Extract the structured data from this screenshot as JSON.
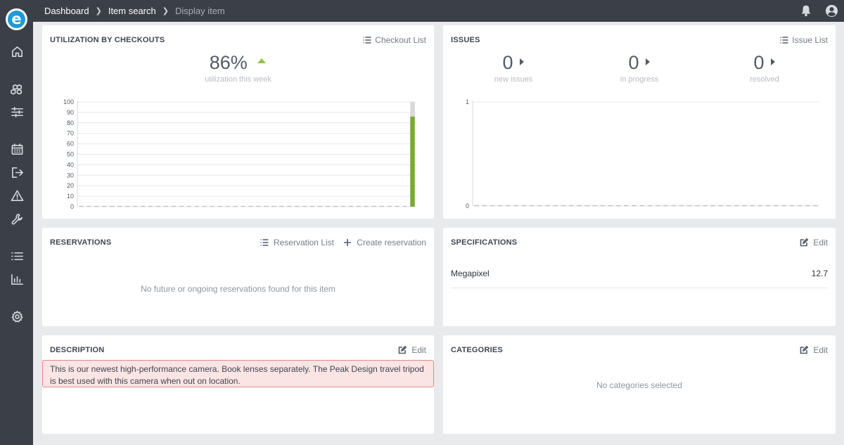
{
  "breadcrumb": {
    "items": [
      "Dashboard",
      "Item search",
      "Display item"
    ]
  },
  "sidebar": {
    "logo_letter": "e",
    "icons": [
      "home-icon",
      "boxes-icon",
      "sliders-icon",
      "calendar-icon",
      "checkout-icon",
      "warning-icon",
      "wrench-icon",
      "list-icon",
      "bar-chart-icon",
      "gear-icon"
    ]
  },
  "topbar": {
    "icons": [
      "bell-icon",
      "user-avatar-icon"
    ]
  },
  "utilization": {
    "title": "UTILIZATION BY CHECKOUTS",
    "action": "Checkout List",
    "value": "86%",
    "caption": "utilization this week",
    "trend_color": "#8cc63f"
  },
  "issues": {
    "title": "ISSUES",
    "action": "Issue List",
    "metrics": [
      {
        "value": "0",
        "label": "new issues"
      },
      {
        "value": "0",
        "label": "in progress"
      },
      {
        "value": "0",
        "label": "resolved"
      }
    ]
  },
  "reservations": {
    "title": "RESERVATIONS",
    "action_list": "Reservation List",
    "action_create": "Create reservation",
    "empty": "No future or ongoing reservations found for this item"
  },
  "specifications": {
    "title": "SPECIFICATIONS",
    "action": "Edit",
    "rows": [
      {
        "key": "Megapixel",
        "value": "12.7"
      }
    ]
  },
  "description": {
    "title": "DESCRIPTION",
    "action": "Edit",
    "text": "This is our newest high-performance camera. Book lenses separately. The Peak Design travel tripod is best used with this camera when out on location."
  },
  "categories": {
    "title": "CATEGORIES",
    "action": "Edit",
    "empty": "No categories selected"
  },
  "chart_data": [
    {
      "type": "bar",
      "ylim": [
        0,
        100
      ],
      "yticks": [
        0,
        10,
        20,
        30,
        40,
        50,
        60,
        70,
        80,
        90,
        100
      ],
      "values": [
        0,
        0,
        0,
        0,
        0,
        0,
        0,
        0,
        0,
        0,
        0,
        0,
        0,
        0,
        0,
        0,
        0,
        0,
        0,
        0,
        0,
        0,
        0,
        0,
        0,
        0,
        0,
        0,
        0,
        0,
        0,
        0,
        0,
        0,
        0,
        0,
        0,
        0,
        0,
        0,
        0,
        0,
        0,
        86
      ],
      "remainder": 14,
      "bar_color": "#7aab35",
      "remainder_color": "#d9d9d9",
      "grid": true
    },
    {
      "type": "bar",
      "ylim": [
        0,
        1
      ],
      "yticks": [
        0,
        1
      ],
      "values": [
        0,
        0,
        0,
        0,
        0,
        0,
        0,
        0,
        0,
        0,
        0,
        0,
        0,
        0,
        0,
        0,
        0,
        0,
        0,
        0,
        0,
        0,
        0,
        0,
        0,
        0,
        0,
        0,
        0,
        0,
        0,
        0,
        0,
        0,
        0,
        0,
        0,
        0,
        0,
        0,
        0,
        0,
        0,
        0
      ],
      "grid": true
    }
  ]
}
